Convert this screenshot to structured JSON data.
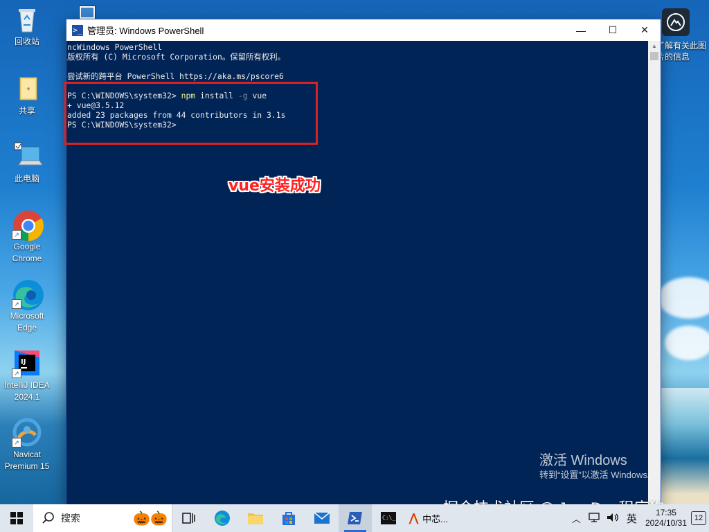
{
  "desktop": {
    "icons": [
      {
        "label": "回收站"
      },
      {
        "label": "共享"
      },
      {
        "label": "此电脑"
      },
      {
        "label": "Google Chrome"
      },
      {
        "label": "Microsoft Edge"
      },
      {
        "label": "IntelliJ IDEA 2024.1"
      },
      {
        "label": "Navicat Premium 15"
      }
    ],
    "right_widget": {
      "label_line1": "了解有关此图",
      "label_line2": "片的信息"
    }
  },
  "window": {
    "title": "管理员: Windows PowerShell",
    "minimize": "—",
    "maximize": "☐",
    "close": "✕",
    "console": {
      "line1": "ncWindows PowerShell",
      "line2": "版权所有 (C) Microsoft Corporation。保留所有权利。",
      "line3": "",
      "line4": "尝试新的跨平台 PowerShell https://aka.ms/pscore6",
      "line5": "",
      "prompt1": "PS C:\\WINDOWS\\system32> ",
      "cmd": "npm",
      "cmd_args1": " install ",
      "cmd_param": "-g",
      "cmd_args2": " vue",
      "out1": "+ vue@3.5.12",
      "out2": "added 23 packages from 44 contributors in 3.1s",
      "prompt2": "PS C:\\WINDOWS\\system32>"
    }
  },
  "annotation": {
    "text": "vue安装成功",
    "color": "#ff2020"
  },
  "activation": {
    "line1": "激活 Windows",
    "line2": "转到“设置”以激活 Windows。"
  },
  "watermark": "掘金技术社区 @ JavaDog程序狗",
  "taskbar": {
    "search_placeholder": "搜索",
    "running_app_label": "中芯...",
    "ime": "英",
    "time": "17:35",
    "date": "2024/10/31",
    "notifications": "12"
  }
}
